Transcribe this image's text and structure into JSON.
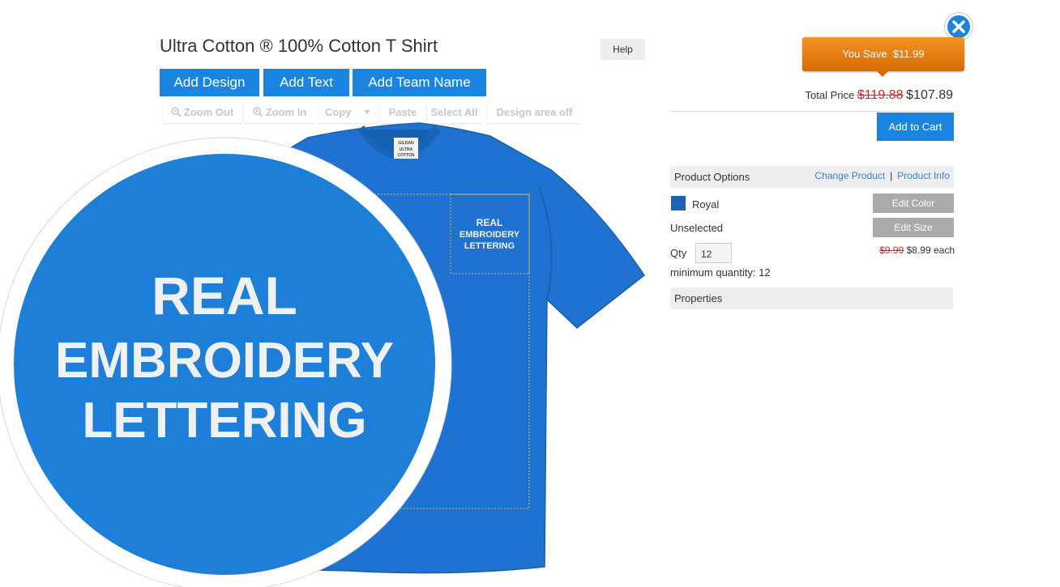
{
  "product": {
    "title": "Ultra Cotton ® 100% Cotton T Shirt"
  },
  "help_label": "Help",
  "add_buttons": {
    "design": "Add Design",
    "text": "Add Text",
    "team": "Add Team Name"
  },
  "toolbar": {
    "zoom_out": "Zoom Out",
    "zoom_in": "Zoom In",
    "copy": "Copy",
    "paste": "Paste",
    "select_all": "Select All",
    "design_area": "Design area off"
  },
  "shirt": {
    "color": "#1f72d1",
    "tag_lines": [
      "GILDAN",
      "ULTRA",
      "COTTON"
    ],
    "pocket_text": [
      "REAL",
      "EMBROIDERY",
      "LETTERING"
    ],
    "zoom_text": [
      "REAL",
      "EMBROIDERY",
      "LETTERING"
    ]
  },
  "pricing": {
    "you_save_label": "You Save",
    "you_save_amount": "$11.99",
    "total_label": "Total Price",
    "old_total": "$119.88",
    "new_total": "$107.89",
    "add_to_cart": "Add to Cart"
  },
  "options": {
    "header": "Product Options",
    "change_product": "Change Product",
    "separator": "|",
    "product_info": "Product Info",
    "color_name": "Royal",
    "color_hex": "#1f62b4",
    "edit_color": "Edit Color",
    "size_value": "Unselected",
    "edit_size": "Edit Size",
    "qty_label": "Qty",
    "qty_value": "12",
    "old_each": "$9.99",
    "new_each": "$8.99 each",
    "min_qty": "minimum quantity: 12",
    "properties": "Properties"
  },
  "colors": {
    "accent": "#1a85e0",
    "save": "#e07b10",
    "strike": "#e02020"
  }
}
